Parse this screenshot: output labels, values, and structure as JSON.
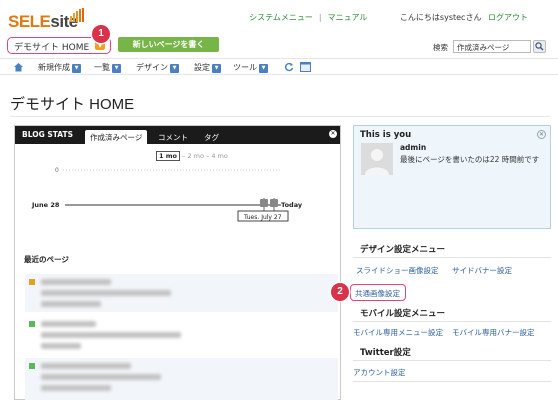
{
  "header": {
    "logo": "SELEsite",
    "site_selector": "デモサイト HOME",
    "new_page_button": "新しいページを書く",
    "links": [
      "システムメニュー",
      "マニュアル"
    ],
    "greeting": "こんにちはsystecさん",
    "logout": "ログアウト",
    "search_label": "検索",
    "search_value": "作成済みページ",
    "badge1": "1",
    "badge2": "2"
  },
  "nav": {
    "items": [
      "新規作成",
      "一覧",
      "デザイン",
      "設定",
      "ツール"
    ]
  },
  "page_title": "デモサイト HOME",
  "blog_stats": {
    "title": "BLOG STATS",
    "tabs": [
      "作成済みページ",
      "コメント",
      "タグ"
    ],
    "range": {
      "current": "1 mo",
      "others": [
        "2 mo",
        "4 mo"
      ]
    },
    "chart_start": "June 28",
    "chart_end": "Today",
    "chart_y_label": "0",
    "tooltip": "Tues. July 27",
    "recent_title": "最近のページ"
  },
  "you": {
    "title": "This is you",
    "name": "admin",
    "desc": "最後にページを書いたのは22 時間前です"
  },
  "design_menu": {
    "title": "デザイン設定メニュー",
    "links": [
      "スライドショー画像設定",
      "サイドバナー設定",
      "共通画像設定"
    ]
  },
  "mobile_menu": {
    "title": "モバイル設定メニュー",
    "links": [
      "モバイル専用メニュー設定",
      "モバイル専用バナー設定"
    ]
  },
  "twitter": {
    "title": "Twitter設定",
    "links": [
      "アカウント設定"
    ]
  },
  "colors": {
    "accent_orange": "#e07a10",
    "green_button": "#78b548",
    "highlight_pink": "#e0457b",
    "badge_red": "#d8334a",
    "link_blue": "#2c5f9e"
  }
}
